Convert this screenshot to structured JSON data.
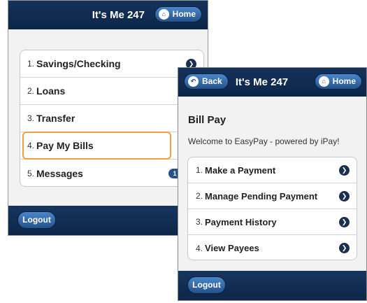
{
  "screen1": {
    "title": "It's Me 247",
    "home_label": "Home",
    "items": [
      {
        "num": "1.",
        "label": "Savings/Checking"
      },
      {
        "num": "2.",
        "label": "Loans"
      },
      {
        "num": "3.",
        "label": "Transfer"
      },
      {
        "num": "4.",
        "label": "Pay My Bills"
      },
      {
        "num": "5.",
        "label": "Messages",
        "badge": "1 unread"
      }
    ],
    "logout_label": "Logout"
  },
  "screen2": {
    "title": "It's Me 247",
    "back_label": "Back",
    "home_label": "Home",
    "heading": "Bill Pay",
    "welcome": "Welcome to EasyPay - powered by iPay!",
    "items": [
      {
        "num": "1.",
        "label": "Make a Payment"
      },
      {
        "num": "2.",
        "label": "Manage Pending Payment"
      },
      {
        "num": "3.",
        "label": "Payment History"
      },
      {
        "num": "4.",
        "label": "View Payees"
      }
    ],
    "logout_label": "Logout"
  },
  "icons": {
    "home": "home-icon",
    "back": "back-arrow-icon",
    "chevron": "chevron-right-icon"
  },
  "colors": {
    "header": "#15325b",
    "button": "#3a72b5",
    "highlight": "#f0a040"
  }
}
